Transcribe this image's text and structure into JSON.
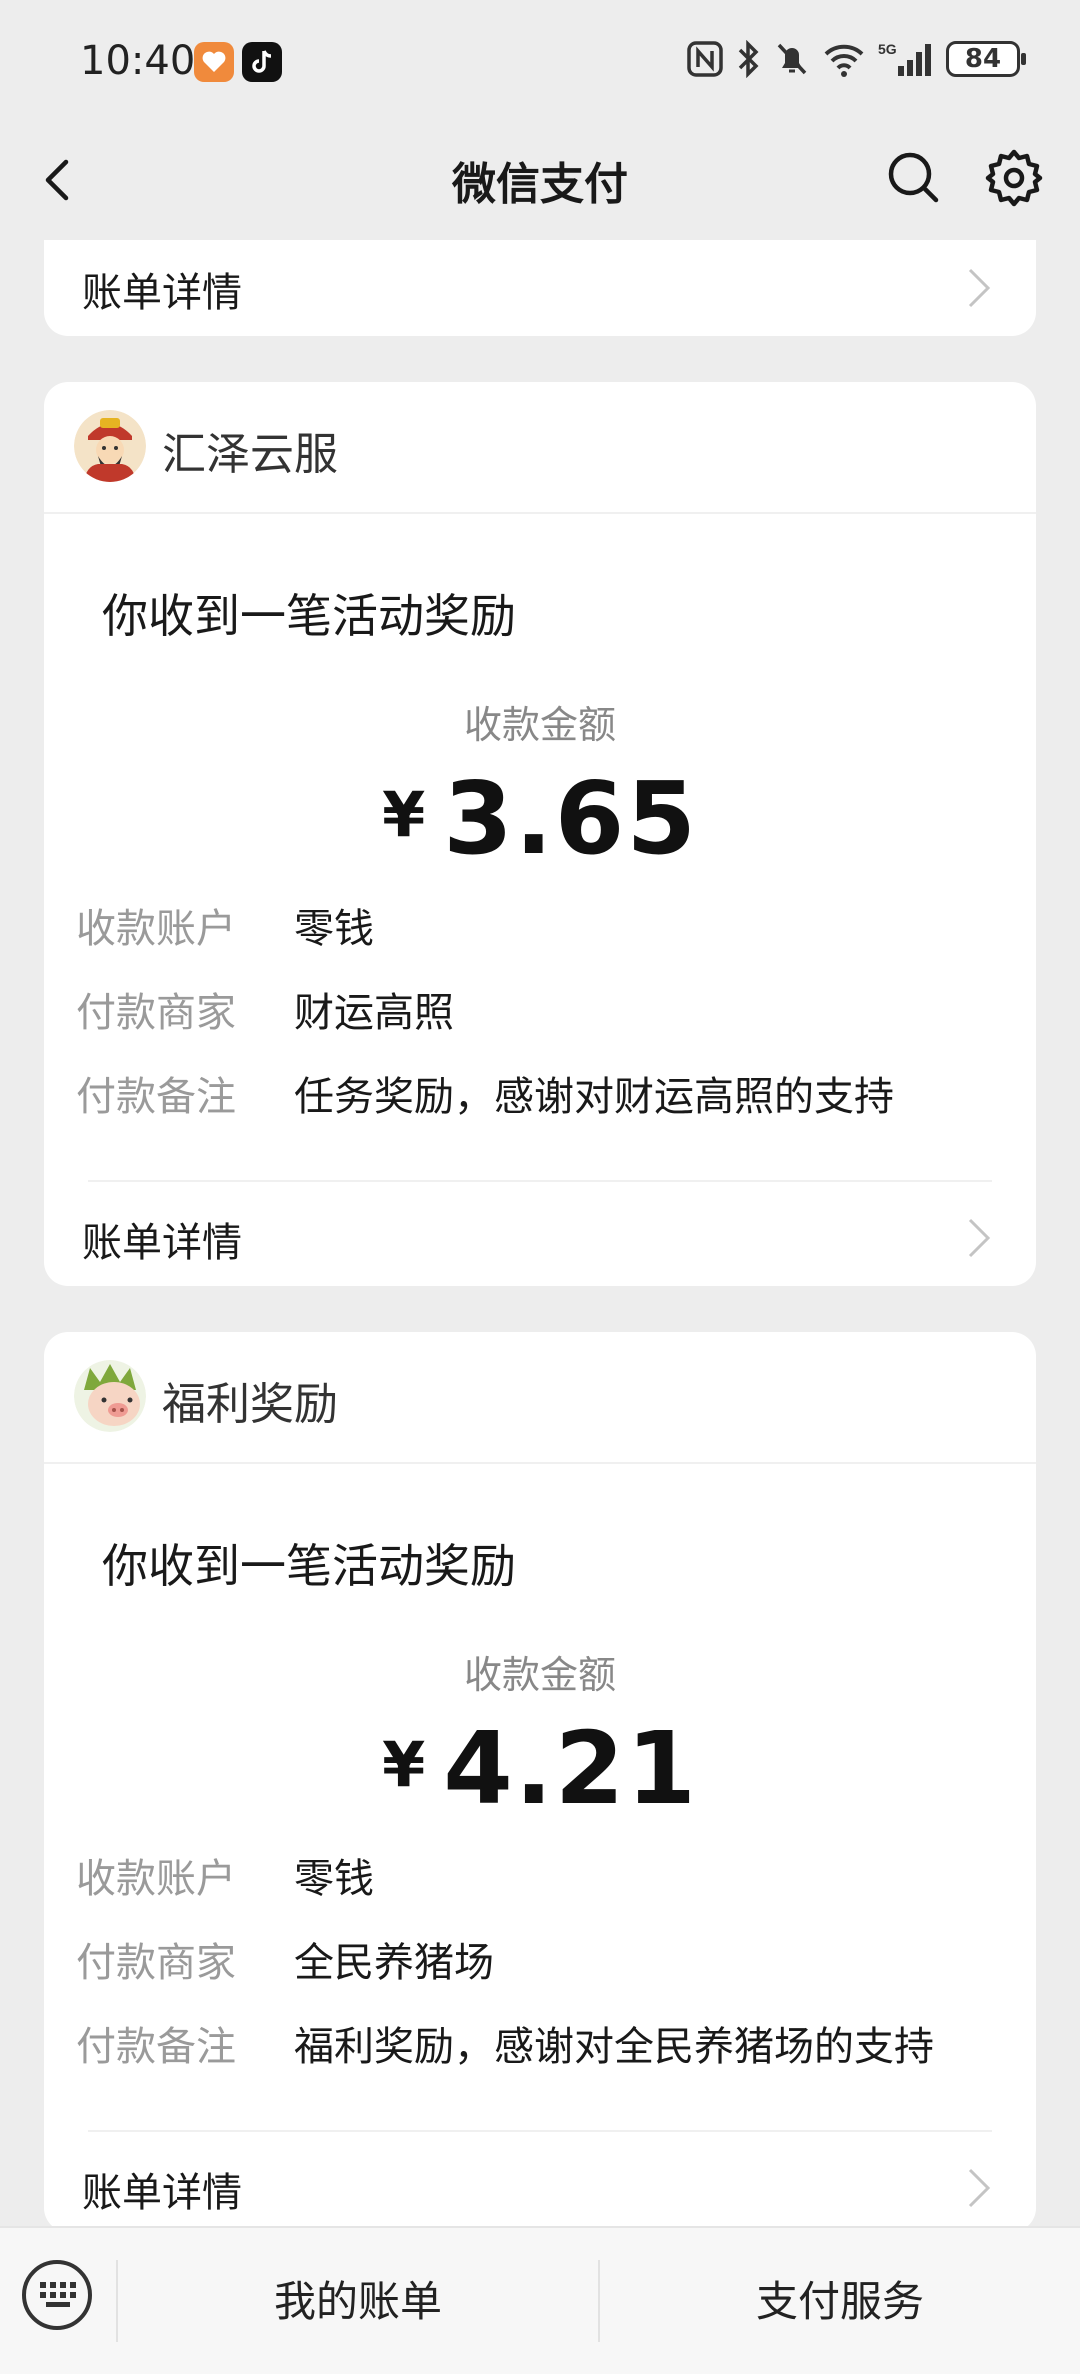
{
  "status_bar": {
    "time": "10:40",
    "battery": "84",
    "icons": [
      "heart-app-icon",
      "tiktok-icon",
      "nfc-icon",
      "bluetooth-icon",
      "mute-icon",
      "wifi-icon",
      "5g-signal-icon",
      "battery-icon"
    ]
  },
  "navbar": {
    "title": "微信支付",
    "icons": [
      "back-arrow-icon",
      "search-icon",
      "gear-icon"
    ]
  },
  "top_card": {
    "detail_label": "账单详情"
  },
  "messages": [
    {
      "merchant": "汇泽云服",
      "headline": "你收到一笔活动奖励",
      "amount_label": "收款金额",
      "currency": "¥",
      "amount": "3.65",
      "rows": [
        {
          "key": "收款账户",
          "value": "零钱"
        },
        {
          "key": "付款商家",
          "value": "财运高照"
        },
        {
          "key": "付款备注",
          "value": "任务奖励，感谢对财运高照的支持"
        }
      ],
      "detail_label": "账单详情"
    },
    {
      "merchant": "福利奖励",
      "headline": "你收到一笔活动奖励",
      "amount_label": "收款金额",
      "currency": "¥",
      "amount": "4.21",
      "rows": [
        {
          "key": "收款账户",
          "value": "零钱"
        },
        {
          "key": "付款商家",
          "value": "全民养猪场"
        },
        {
          "key": "付款备注",
          "value": "福利奖励，感谢对全民养猪场的支持"
        }
      ],
      "detail_label": "账单详情"
    }
  ],
  "bottom_bar": {
    "keyboard_icon": "keyboard-icon",
    "tabs": [
      "我的账单",
      "支付服务"
    ]
  }
}
